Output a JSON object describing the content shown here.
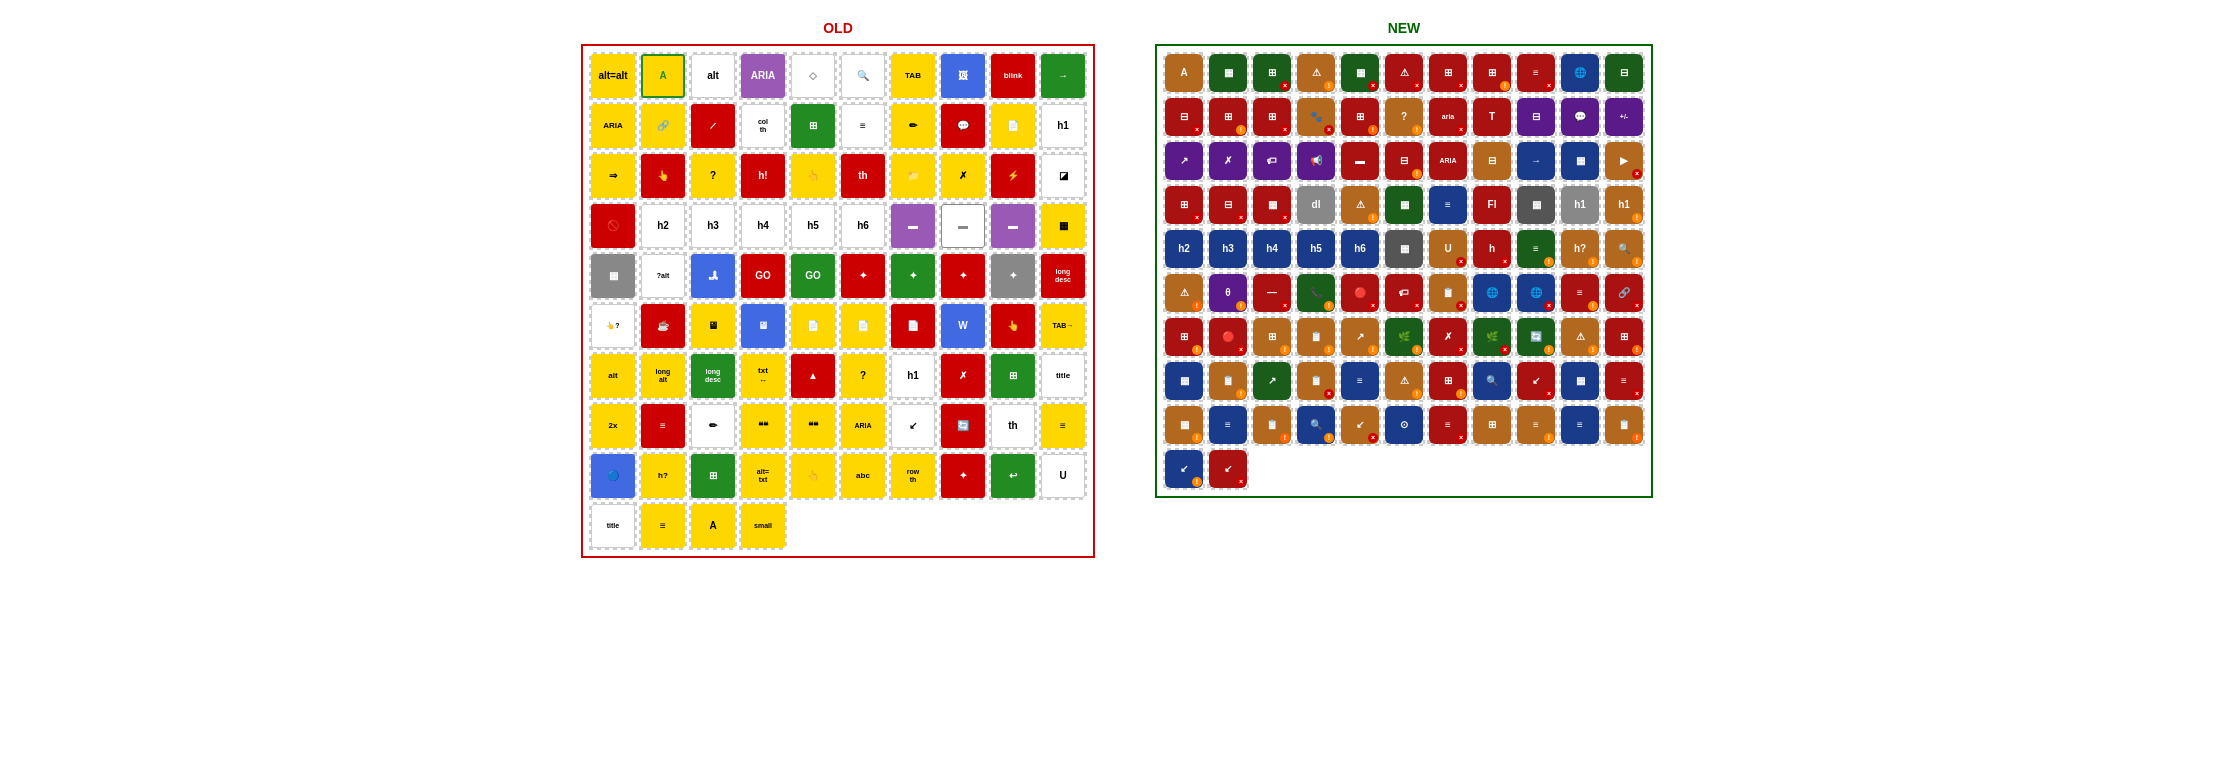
{
  "old_panel": {
    "title": "OLD",
    "icons": [
      {
        "label": "alt=alt",
        "bg": "yellow"
      },
      {
        "label": "A",
        "bg": "yellow",
        "border": "green"
      },
      {
        "label": "alt",
        "bg": "white"
      },
      {
        "label": "ARIA",
        "bg": "purple"
      },
      {
        "label": "",
        "bg": "white",
        "shape": "diamond"
      },
      {
        "label": "🔍",
        "bg": "white"
      },
      {
        "label": "TAB",
        "bg": "yellow"
      },
      {
        "label": "",
        "bg": "blue",
        "shape": "img"
      },
      {
        "label": "blink",
        "bg": "red"
      },
      {
        "label": "→",
        "bg": "green"
      },
      {
        "label": "ARIA",
        "bg": "yellow"
      },
      {
        "label": "🔗",
        "bg": "yellow"
      },
      {
        "label": "✗",
        "bg": "red",
        "slash": true
      },
      {
        "label": "col th",
        "bg": "white"
      },
      {
        "label": "",
        "bg": "green",
        "shape": "grid"
      },
      {
        "label": "",
        "bg": "white",
        "shape": "list"
      },
      {
        "label": "",
        "bg": "yellow",
        "shape": "pencil"
      },
      {
        "label": "💬",
        "bg": "red"
      },
      {
        "label": "",
        "bg": "yellow",
        "shape": "doc"
      },
      {
        "label": "h1",
        "bg": "white"
      },
      {
        "label": "⇒",
        "bg": "yellow"
      },
      {
        "label": "",
        "bg": "red",
        "shape": "hand"
      },
      {
        "label": "?",
        "bg": "yellow"
      },
      {
        "label": "h!",
        "bg": "red"
      },
      {
        "label": "👆",
        "bg": "yellow"
      },
      {
        "label": "th",
        "bg": "red"
      },
      {
        "label": "",
        "bg": "yellow",
        "shape": "folder"
      },
      {
        "label": "✗",
        "bg": "yellow"
      },
      {
        "label": "⚡",
        "bg": "red"
      },
      {
        "label": "",
        "bg": "white"
      },
      {
        "label": "🚫",
        "bg": "red"
      },
      {
        "label": "h2",
        "bg": "white"
      },
      {
        "label": "h3",
        "bg": "white"
      },
      {
        "label": "h4",
        "bg": "white"
      },
      {
        "label": "h5",
        "bg": "white"
      },
      {
        "label": "h6",
        "bg": "white"
      },
      {
        "label": "",
        "bg": "purple",
        "shape": "monitor"
      },
      {
        "label": "",
        "bg": "white",
        "shape": "monitor2"
      },
      {
        "label": "",
        "bg": "purple",
        "shape": "bar"
      },
      {
        "label": "",
        "bg": "yellow",
        "shape": "monitor3"
      },
      {
        "label": "",
        "bg": "gray",
        "shape": "monitor4"
      },
      {
        "label": "?alt",
        "bg": "white"
      },
      {
        "label": "",
        "bg": "blue",
        "shape": "landscape"
      },
      {
        "label": "GO",
        "bg": "red"
      },
      {
        "label": "GO",
        "bg": "green"
      },
      {
        "label": "",
        "bg": "red",
        "shape": "star"
      },
      {
        "label": "",
        "bg": "green",
        "shape": "star2"
      },
      {
        "label": "",
        "bg": "red",
        "shape": "star3"
      },
      {
        "label": "",
        "bg": "gray",
        "shape": "box"
      },
      {
        "label": "long desc",
        "bg": "red"
      },
      {
        "label": "👆?",
        "bg": "white"
      },
      {
        "label": "☕",
        "bg": "red"
      },
      {
        "label": "",
        "bg": "yellow",
        "shape": "monitor5"
      },
      {
        "label": "",
        "bg": "blue",
        "shape": "screen"
      },
      {
        "label": "",
        "bg": "yellow",
        "shape": "doc2"
      },
      {
        "label": "",
        "bg": "yellow",
        "shape": "pdf"
      },
      {
        "label": "",
        "bg": "red",
        "shape": "ppt"
      },
      {
        "label": "W",
        "bg": "blue"
      },
      {
        "label": "",
        "bg": "red",
        "shape": "hand2"
      },
      {
        "label": "TAB→",
        "bg": "yellow"
      },
      {
        "label": "alt",
        "bg": "yellow"
      },
      {
        "label": "long alt",
        "bg": "yellow"
      },
      {
        "label": "long desc",
        "bg": "green"
      },
      {
        "label": "txt↔",
        "bg": "yellow"
      },
      {
        "label": "▲",
        "bg": "red"
      },
      {
        "label": "?",
        "bg": "yellow",
        "shape": "bracket"
      },
      {
        "label": "h1",
        "bg": "white"
      },
      {
        "label": "✗",
        "bg": "red",
        "slash2": true
      },
      {
        "label": "",
        "bg": "green",
        "shape": "grid2"
      },
      {
        "label": "title",
        "bg": "white"
      },
      {
        "label": "2x",
        "bg": "yellow"
      },
      {
        "label": "≡",
        "bg": "red"
      },
      {
        "label": "✏",
        "bg": "white"
      },
      {
        "label": "❝❝",
        "bg": "yellow"
      },
      {
        "label": "❝❝",
        "bg": "yellow"
      },
      {
        "label": "ARIA",
        "bg": "yellow",
        "small": true
      },
      {
        "label": "↙",
        "bg": "white"
      },
      {
        "label": "🔄",
        "bg": "red"
      },
      {
        "label": "th",
        "bg": "white"
      },
      {
        "label": "≡",
        "bg": "yellow"
      },
      {
        "label": "🔵",
        "bg": "blue"
      },
      {
        "label": "h?",
        "bg": "yellow"
      },
      {
        "label": "",
        "bg": "green",
        "shape": "table"
      },
      {
        "label": "alt=txt",
        "bg": "yellow"
      },
      {
        "label": "👆",
        "bg": "yellow",
        "shape": "pointer"
      },
      {
        "label": "abc",
        "bg": "yellow"
      },
      {
        "label": "row th",
        "bg": "yellow"
      },
      {
        "label": "",
        "bg": "red",
        "shape": "star4"
      },
      {
        "label": "↩",
        "bg": "green"
      },
      {
        "label": "U",
        "bg": "white"
      },
      {
        "label": "title",
        "bg": "white",
        "small": true
      },
      {
        "label": "≡",
        "bg": "yellow",
        "small2": true
      },
      {
        "label": "A",
        "bg": "yellow",
        "font": true
      },
      {
        "label": "small",
        "bg": "yellow"
      }
    ]
  },
  "new_panel": {
    "title": "NEW",
    "icons": [
      {
        "label": "A",
        "color": "orange",
        "badge": ""
      },
      {
        "label": "▦",
        "color": "darkgreen",
        "badge": ""
      },
      {
        "label": "⊞",
        "color": "darkgreen",
        "badge": "x"
      },
      {
        "label": "⚠A",
        "color": "orange",
        "badge": "warn"
      },
      {
        "label": "▦",
        "color": "darkgreen",
        "badge": "x"
      },
      {
        "label": "⚠",
        "color": "red",
        "badge": "x"
      },
      {
        "label": "⊞x",
        "color": "red",
        "badge": "x"
      },
      {
        "label": "⚠⊞",
        "color": "red",
        "badge": "warn"
      },
      {
        "label": "≡",
        "color": "red",
        "badge": "x"
      },
      {
        "label": "🌐",
        "color": "blue",
        "badge": ""
      },
      {
        "label": "⊟",
        "color": "darkgreen",
        "badge": ""
      },
      {
        "label": "⊟",
        "color": "red",
        "badge": "x"
      },
      {
        "label": "⊞",
        "color": "red",
        "badge": "warn"
      },
      {
        "label": "⊞",
        "color": "red",
        "badge": "x"
      },
      {
        "label": "🐾",
        "color": "orange",
        "badge": "x"
      },
      {
        "label": "⊞",
        "color": "red",
        "badge": "warn2"
      },
      {
        "label": "?",
        "color": "orange",
        "badge": "warn"
      },
      {
        "label": "aria",
        "color": "red",
        "badge": "x"
      },
      {
        "label": "T",
        "color": "red",
        "badge": ""
      },
      {
        "label": "⊟",
        "color": "purple",
        "badge": ""
      },
      {
        "label": "💬",
        "color": "purple",
        "badge": ""
      },
      {
        "label": "+/-",
        "color": "purple",
        "badge": ""
      },
      {
        "label": "↗",
        "color": "purple",
        "badge": ""
      },
      {
        "label": "✗",
        "color": "purple",
        "badge": ""
      },
      {
        "label": "🏷",
        "color": "purple",
        "badge": ""
      },
      {
        "label": "📢",
        "color": "purple",
        "badge": ""
      },
      {
        "label": "▬",
        "color": "red",
        "badge": ""
      },
      {
        "label": "⊟",
        "color": "red",
        "badge": "warn"
      },
      {
        "label": "ARIA",
        "color": "red",
        "badge": ""
      },
      {
        "label": "⊟",
        "color": "orange",
        "badge": ""
      },
      {
        "label": "→",
        "color": "blue",
        "badge": ""
      },
      {
        "label": "▦",
        "color": "blue",
        "badge": ""
      },
      {
        "label": "▶",
        "color": "orange",
        "badge": "x"
      },
      {
        "label": "⊞",
        "color": "red",
        "badge": "x"
      },
      {
        "label": "⊟",
        "color": "red",
        "badge": "x"
      },
      {
        "label": "▦",
        "color": "red",
        "badge": "x"
      },
      {
        "label": "dl",
        "color": "white",
        "badge": ""
      },
      {
        "label": "⚠A",
        "color": "orange",
        "badge": "warn"
      },
      {
        "label": "▦",
        "color": "darkgreen",
        "badge": ""
      },
      {
        "label": "≡",
        "color": "blue",
        "badge": ""
      },
      {
        "label": "Fl",
        "color": "red",
        "badge": ""
      },
      {
        "label": "▦",
        "color": "gray",
        "badge": ""
      },
      {
        "label": "h1",
        "color": "white",
        "badge": ""
      },
      {
        "label": "h1⚠",
        "color": "orange",
        "badge": "warn"
      },
      {
        "label": "h2",
        "color": "blue",
        "badge": ""
      },
      {
        "label": "h3",
        "color": "blue",
        "badge": ""
      },
      {
        "label": "h4",
        "color": "blue",
        "badge": ""
      },
      {
        "label": "h5",
        "color": "blue",
        "badge": ""
      },
      {
        "label": "h6",
        "color": "blue",
        "badge": ""
      },
      {
        "label": "▦",
        "color": "gray",
        "badge": ""
      },
      {
        "label": "U",
        "color": "orange",
        "badge": "x"
      },
      {
        "label": "h",
        "color": "red",
        "badge": "x"
      },
      {
        "label": "≡",
        "color": "darkgreen",
        "badge": "warn"
      },
      {
        "label": "h?",
        "color": "orange",
        "badge": "warn"
      },
      {
        "label": "🔍",
        "color": "orange",
        "badge": "warn"
      },
      {
        "label": "⚠A",
        "color": "orange",
        "badge": "warn2"
      },
      {
        "label": "θ",
        "color": "purple",
        "badge": "warn"
      },
      {
        "label": "—",
        "color": "red",
        "badge": "x"
      },
      {
        "label": "📞",
        "color": "darkgreen",
        "badge": "warn"
      },
      {
        "label": "🔴",
        "color": "red",
        "badge": "x"
      },
      {
        "label": "🏷",
        "color": "red",
        "badge": "x"
      },
      {
        "label": "📋",
        "color": "orange",
        "badge": "x"
      },
      {
        "label": "🌐",
        "color": "blue",
        "badge": ""
      },
      {
        "label": "🌐",
        "color": "blue",
        "badge": "x"
      },
      {
        "label": "≡",
        "color": "red",
        "badge": "warn"
      },
      {
        "label": "🔗",
        "color": "red",
        "badge": "x"
      },
      {
        "label": "⊞",
        "color": "red",
        "badge": "warn"
      },
      {
        "label": "🔴",
        "color": "red",
        "badge": "x"
      },
      {
        "label": "⊞",
        "color": "orange",
        "badge": "warn"
      },
      {
        "label": "📋",
        "color": "orange",
        "badge": "warn"
      },
      {
        "label": "↗",
        "color": "orange",
        "badge": "warn"
      },
      {
        "label": "🌿",
        "color": "darkgreen",
        "badge": "warn"
      },
      {
        "label": "✗",
        "color": "red",
        "badge": "x"
      },
      {
        "label": "🌿",
        "color": "darkgreen",
        "badge": "x"
      },
      {
        "label": "🔄",
        "color": "darkgreen",
        "badge": "warn"
      },
      {
        "label": "⚠",
        "color": "orange",
        "badge": "warn"
      },
      {
        "label": "⊞",
        "color": "red",
        "badge": "warn2"
      },
      {
        "label": "▦",
        "color": "blue",
        "badge": ""
      },
      {
        "label": "📋",
        "color": "orange",
        "badge": "warn"
      },
      {
        "label": "↗",
        "color": "darkgreen",
        "badge": ""
      },
      {
        "label": "📋",
        "color": "orange",
        "badge": "x"
      },
      {
        "label": "≡",
        "color": "blue",
        "badge": ""
      },
      {
        "label": "⚠",
        "color": "orange",
        "badge": "warn"
      },
      {
        "label": "⊞",
        "color": "red",
        "badge": "warn"
      },
      {
        "label": "🔍",
        "color": "blue",
        "badge": ""
      },
      {
        "label": "↙",
        "color": "red",
        "badge": "x"
      },
      {
        "label": "▦",
        "color": "blue",
        "badge": ""
      },
      {
        "label": "≡",
        "color": "red",
        "badge": "x"
      },
      {
        "label": "▦",
        "color": "orange",
        "badge": "warn"
      },
      {
        "label": "≡",
        "color": "blue",
        "badge": ""
      },
      {
        "label": "📋",
        "color": "orange",
        "badge": "warn2"
      },
      {
        "label": "🔍",
        "color": "blue",
        "badge": "warn"
      },
      {
        "label": "↙",
        "color": "orange",
        "badge": "x"
      },
      {
        "label": "⊙",
        "color": "blue",
        "badge": ""
      },
      {
        "label": "≡",
        "color": "red",
        "badge": "x"
      },
      {
        "label": "⊞",
        "color": "orange",
        "badge": ""
      },
      {
        "label": "≡",
        "color": "orange",
        "badge": "warn"
      },
      {
        "label": "≡",
        "color": "blue",
        "badge": ""
      },
      {
        "label": "📋",
        "color": "orange",
        "badge": "warn2"
      },
      {
        "label": "↙",
        "color": "blue",
        "badge": "warn"
      },
      {
        "label": "↙",
        "color": "red",
        "badge": "x"
      }
    ]
  }
}
